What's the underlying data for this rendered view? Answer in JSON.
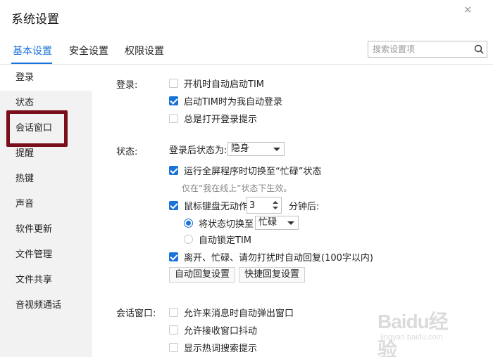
{
  "window": {
    "title": "系统设置",
    "close_glyph": "×"
  },
  "tabs": [
    {
      "label": "基本设置",
      "active": true
    },
    {
      "label": "安全设置",
      "active": false
    },
    {
      "label": "权限设置",
      "active": false
    }
  ],
  "search": {
    "placeholder": "搜索设置项",
    "value": ""
  },
  "sidebar": {
    "items": [
      {
        "label": "登录",
        "active": true
      },
      {
        "label": "状态",
        "active": false
      },
      {
        "label": "会话窗口",
        "active": false,
        "highlighted": true
      },
      {
        "label": "提醒",
        "active": false
      },
      {
        "label": "热键",
        "active": false
      },
      {
        "label": "声音",
        "active": false
      },
      {
        "label": "软件更新",
        "active": false
      },
      {
        "label": "文件管理",
        "active": false
      },
      {
        "label": "文件共享",
        "active": false
      },
      {
        "label": "音视频通话",
        "active": false
      }
    ]
  },
  "login_section": {
    "label": "登录:",
    "options": [
      {
        "label": "开机时自动启动TIM",
        "checked": false
      },
      {
        "label": "启动TIM时为我自动登录",
        "checked": true
      },
      {
        "label": "总是打开登录提示",
        "checked": false
      }
    ]
  },
  "status_section": {
    "label": "状态:",
    "after_login_label": "登录后状态为:",
    "after_login_value": "隐身",
    "fullscreen": {
      "label": "运行全屏程序时切换至“忙碌”状态",
      "checked": true
    },
    "fullscreen_hint": "仅在“我在线上”状态下生效。",
    "idle": {
      "label_before": "鼠标键盘无动作",
      "minutes": "3",
      "label_after": "分钟后:",
      "checked": true
    },
    "idle_switch": {
      "label": "将状态切换至",
      "selected": true,
      "value": "忙碌"
    },
    "idle_lock": {
      "label": "自动锁定TIM",
      "selected": false
    },
    "auto_reply": {
      "label": "离开、忙碌、请勿打扰时自动回复(100字以内)",
      "checked": true
    },
    "buttons": {
      "auto_reply_settings": "自动回复设置",
      "quick_reply_settings": "快捷回复设置"
    }
  },
  "chat_section": {
    "label": "会话窗口:",
    "options": [
      {
        "label": "允许来消息时自动弹出窗口",
        "checked": false
      },
      {
        "label": "允许接收窗口抖动",
        "checked": false
      },
      {
        "label": "显示热词搜索提示",
        "checked": false
      }
    ]
  },
  "watermark": {
    "text": "Baidu经验",
    "sub": "jingyan.baidu.com"
  },
  "colors": {
    "accent": "#1a73d9",
    "sidebar_bg": "#f2f2f2",
    "highlight_box": "#7a0f1c"
  },
  "icons": {
    "search": "search-icon",
    "close": "close-icon"
  }
}
